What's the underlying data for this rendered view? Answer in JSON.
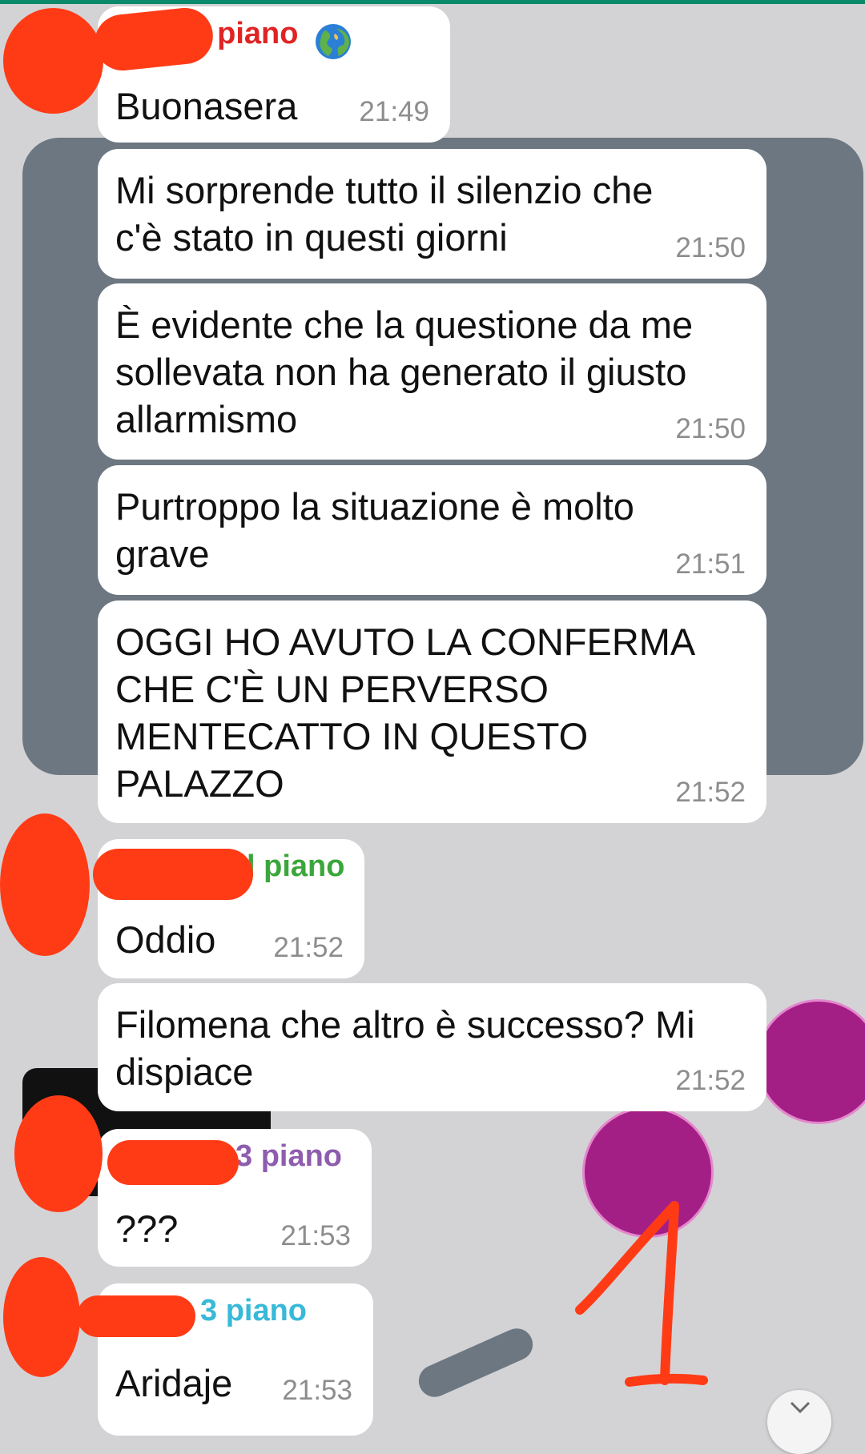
{
  "colors": {
    "background": "#d3d3d6",
    "bubble": "#ffffff",
    "sender_red": "#e02424",
    "sender_green": "#3ba63b",
    "sender_purple": "#8e5dae",
    "sender_cyan": "#38b9d8",
    "redaction": "#ff3b16"
  },
  "messages": [
    {
      "sender": "l piano",
      "sender_icon": "globe-emoji",
      "text": "Buonasera",
      "time": "21:49"
    },
    {
      "text": "Mi sorprende tutto il silenzio che\nc'è stato in questi giorni",
      "time": "21:50"
    },
    {
      "text": "È evidente che la questione da me\nsollevata non ha generato il giusto\nallarmismo",
      "time": "21:50"
    },
    {
      "text": "Purtroppo la situazione è molto\ngrave",
      "time": "21:51"
    },
    {
      "text": "OGGI HO AVUTO LA CONFERMA\nCHE C'È UN PERVERSO\nMENTECATTO IN QUESTO\nPALAZZO",
      "time": "21:52"
    },
    {
      "sender": "l piano",
      "text": "Oddio",
      "time": "21:52"
    },
    {
      "text": "Filomena che altro è successo? Mi\ndispiace",
      "time": "21:52"
    },
    {
      "sender": "3 piano",
      "text": "???",
      "time": "21:53"
    },
    {
      "sender": "3 piano",
      "text": "Aridaje",
      "time": "21:53"
    }
  ],
  "annotation": {
    "text": "1"
  },
  "scroll_down_icon": "chevron-down-icon"
}
